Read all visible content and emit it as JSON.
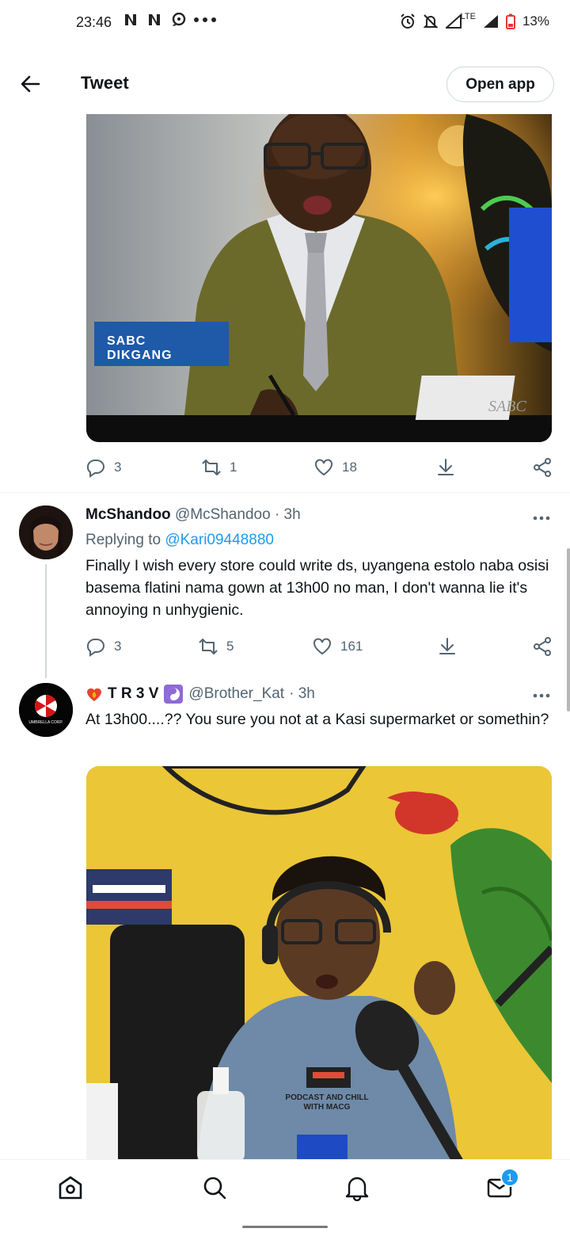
{
  "status_bar": {
    "time": "23:46",
    "left_icons": [
      "netflix-icon",
      "netflix-icon",
      "chat-icon",
      "more-dots-icon"
    ],
    "network": "LTE",
    "battery": "13%"
  },
  "header": {
    "title": "Tweet",
    "open_app_label": "Open app"
  },
  "media1": {
    "channel_logo": "SABC DIKGANG",
    "corner_logo": "SABC"
  },
  "tweet1_actions": {
    "replies": "3",
    "retweets": "1",
    "likes": "18"
  },
  "reply1": {
    "name": "McShandoo",
    "handle": "@McShandoo",
    "time": "· 3h",
    "replying_prefix": "Replying to",
    "replying_to": "@Kari09448880",
    "text": "Finally I wish every store could write ds, uyangena estolo naba osisi basema flatini nama gown at 13h00 no man, I don't wanna lie it's annoying n unhygienic.",
    "replies": "3",
    "retweets": "5",
    "likes": "161"
  },
  "reply2": {
    "name": "T R 3 V",
    "handle": "@Brother_Kat",
    "time": "· 3h",
    "avatar_text": "UMBRELLA CORP.",
    "text": "At 13h00....?? You sure you not at a Kasi supermarket or somethin?",
    "shirt_text": "PODCAST AND CHILL WITH MACG"
  },
  "bottom_nav": {
    "items": [
      "home-icon",
      "search-icon",
      "notifications-icon",
      "messages-icon"
    ],
    "messages_badge": "1"
  },
  "colors": {
    "accent": "#1d9bf0",
    "secondary_text": "#536471",
    "primary_text": "#0f1419"
  }
}
